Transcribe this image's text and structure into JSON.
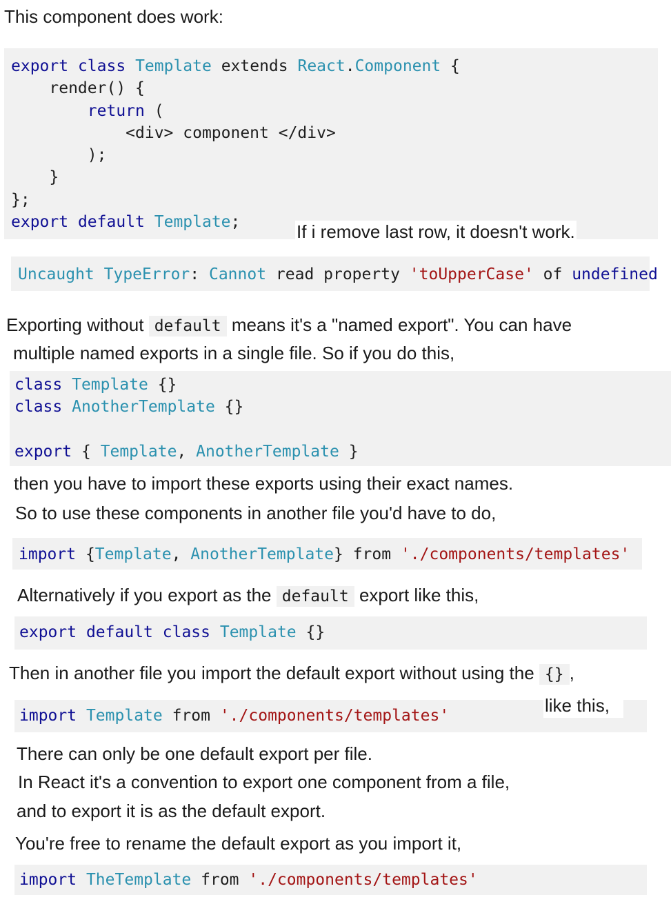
{
  "heading": "This component does work:",
  "code1": {
    "lines": [
      [
        {
          "t": "export",
          "c": "kw"
        },
        {
          "t": " "
        },
        {
          "t": "class",
          "c": "kw"
        },
        {
          "t": " "
        },
        {
          "t": "Template",
          "c": "ty"
        },
        {
          "t": " extends "
        },
        {
          "t": "React",
          "c": "ty"
        },
        {
          "t": "."
        },
        {
          "t": "Component",
          "c": "ty"
        },
        {
          "t": " {"
        }
      ],
      [
        {
          "t": "    render() {"
        }
      ],
      [
        {
          "t": "        "
        },
        {
          "t": "return",
          "c": "kw"
        },
        {
          "t": " ("
        }
      ],
      [
        {
          "t": "            <div> component </div>"
        }
      ],
      [
        {
          "t": "        );"
        }
      ],
      [
        {
          "t": "    }"
        }
      ],
      [
        {
          "t": "};"
        }
      ],
      [
        {
          "t": "export",
          "c": "kw"
        },
        {
          "t": " "
        },
        {
          "t": "default",
          "c": "kw"
        },
        {
          "t": " "
        },
        {
          "t": "Template",
          "c": "ty"
        },
        {
          "t": ";"
        }
      ]
    ]
  },
  "note_remove": "If i remove last row, it doesn't work.",
  "error_code": {
    "lines": [
      [
        {
          "t": "Uncaught",
          "c": "ty"
        },
        {
          "t": " "
        },
        {
          "t": "TypeError",
          "c": "ty"
        },
        {
          "t": ": "
        },
        {
          "t": "Cannot",
          "c": "ty"
        },
        {
          "t": " read property "
        },
        {
          "t": "'toUpperCase'",
          "c": "st"
        },
        {
          "t": " of "
        },
        {
          "t": "undefined",
          "c": "kw"
        }
      ]
    ]
  },
  "para1": {
    "before": "Exporting without",
    "code": "default",
    "after": "means it's a \"named export\". You can have",
    "line2": "multiple named exports in a single file. So if you do this,"
  },
  "code2": {
    "lines": [
      [
        {
          "t": "class",
          "c": "kw"
        },
        {
          "t": " "
        },
        {
          "t": "Template",
          "c": "ty"
        },
        {
          "t": " {}"
        }
      ],
      [
        {
          "t": "class",
          "c": "kw"
        },
        {
          "t": " "
        },
        {
          "t": "AnotherTemplate",
          "c": "ty"
        },
        {
          "t": " {}"
        }
      ],
      [
        {
          "t": ""
        }
      ],
      [
        {
          "t": "export",
          "c": "kw"
        },
        {
          "t": " { "
        },
        {
          "t": "Template",
          "c": "ty"
        },
        {
          "t": ", "
        },
        {
          "t": "AnotherTemplate",
          "c": "ty"
        },
        {
          "t": " }"
        }
      ]
    ]
  },
  "para2": {
    "line1": "then you have to import these exports using their exact names.",
    "line2": "So to use these components in another file you'd have to do,"
  },
  "code3": {
    "lines": [
      [
        {
          "t": "import",
          "c": "kw"
        },
        {
          "t": " {"
        },
        {
          "t": "Template",
          "c": "ty"
        },
        {
          "t": ", "
        },
        {
          "t": "AnotherTemplate",
          "c": "ty"
        },
        {
          "t": "} from "
        },
        {
          "t": "'./components/templates'",
          "c": "st"
        }
      ]
    ]
  },
  "para3": {
    "before": "Alternatively if you export as the",
    "code": "default",
    "after": "export like this,"
  },
  "code4": {
    "lines": [
      [
        {
          "t": "export",
          "c": "kw"
        },
        {
          "t": " "
        },
        {
          "t": "default",
          "c": "kw"
        },
        {
          "t": " "
        },
        {
          "t": "class",
          "c": "kw"
        },
        {
          "t": " "
        },
        {
          "t": "Template",
          "c": "ty"
        },
        {
          "t": " {}"
        }
      ]
    ]
  },
  "para4": {
    "before": "Then in another file you import the default export without using the",
    "code": "{}",
    "after": ","
  },
  "note_like": "like this,",
  "code5": {
    "lines": [
      [
        {
          "t": "import",
          "c": "kw"
        },
        {
          "t": " "
        },
        {
          "t": "Template",
          "c": "ty"
        },
        {
          "t": " from "
        },
        {
          "t": "'./components/templates'",
          "c": "st"
        }
      ]
    ]
  },
  "para5": {
    "line1": "There can only be one default export per file.",
    "line2": "In React it's a convention to export one component from a file,",
    "line3": "and to export it is as the default export.",
    "line4": "You're free to rename the default export as you import it,"
  },
  "code6": {
    "lines": [
      [
        {
          "t": "import",
          "c": "kw"
        },
        {
          "t": " "
        },
        {
          "t": "TheTemplate",
          "c": "ty"
        },
        {
          "t": " from "
        },
        {
          "t": "'./components/templates'",
          "c": "st"
        }
      ]
    ]
  }
}
